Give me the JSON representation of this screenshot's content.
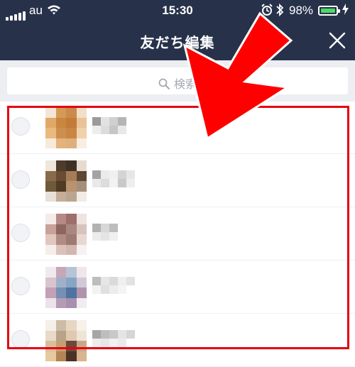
{
  "status_bar": {
    "carrier": "au",
    "time": "15:30",
    "battery": "98%"
  },
  "header": {
    "title": "友だち編集",
    "close_icon": "close-icon"
  },
  "search": {
    "placeholder": "検索",
    "icon": "search-icon"
  },
  "friends": [
    {
      "name": "",
      "selected": false
    },
    {
      "name": "",
      "selected": false
    },
    {
      "name": "",
      "selected": false
    },
    {
      "name": "",
      "selected": false
    },
    {
      "name": "",
      "selected": false
    }
  ],
  "annotation": {
    "highlight_color": "#e60012",
    "arrow_color": "#ff0000"
  },
  "colors": {
    "header_bg": "#27324a",
    "search_bg": "#eceef2",
    "battery": "#4cd964"
  }
}
